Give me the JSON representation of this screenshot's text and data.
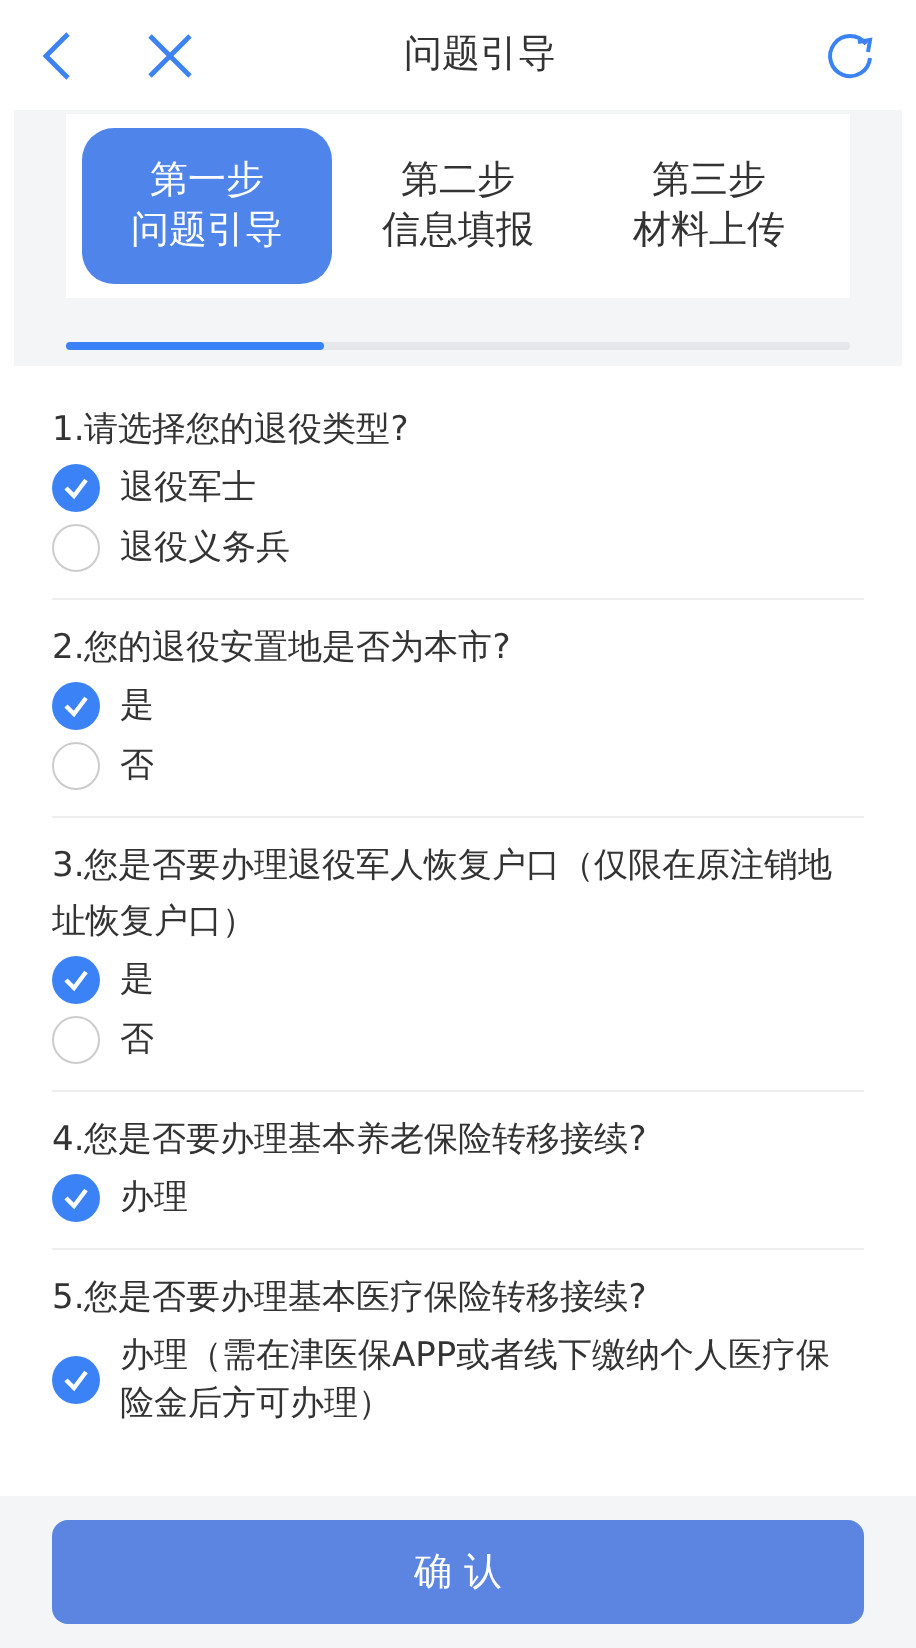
{
  "header": {
    "title": "问题引导"
  },
  "steps": [
    {
      "step": "第一步",
      "label": "问题引导",
      "selected": true
    },
    {
      "step": "第二步",
      "label": "信息填报",
      "selected": false
    },
    {
      "step": "第三步",
      "label": "材料上传",
      "selected": false
    }
  ],
  "progress": {
    "level": 0.33
  },
  "questions": [
    {
      "text": "1.请选择您的退役类型?",
      "options": [
        {
          "label": "退役军士",
          "checked": true
        },
        {
          "label": "退役义务兵",
          "checked": false
        }
      ]
    },
    {
      "text": "2.您的退役安置地是否为本市?",
      "options": [
        {
          "label": "是",
          "checked": true
        },
        {
          "label": "否",
          "checked": false
        }
      ]
    },
    {
      "text": "3.您是否要办理退役军人恢复户口（仅限在原注销地址恢复户口）",
      "options": [
        {
          "label": "是",
          "checked": true
        },
        {
          "label": "否",
          "checked": false
        }
      ]
    },
    {
      "text": "4.您是否要办理基本养老保险转移接续?",
      "options": [
        {
          "label": "办理",
          "checked": true
        }
      ]
    },
    {
      "text": "5.您是否要办理基本医疗保险转移接续?",
      "options": [
        {
          "label": "办理（需在津医保APP或者线下缴纳个人医疗保险金后方可办理）",
          "checked": true
        }
      ]
    }
  ],
  "confirm": "确 认"
}
